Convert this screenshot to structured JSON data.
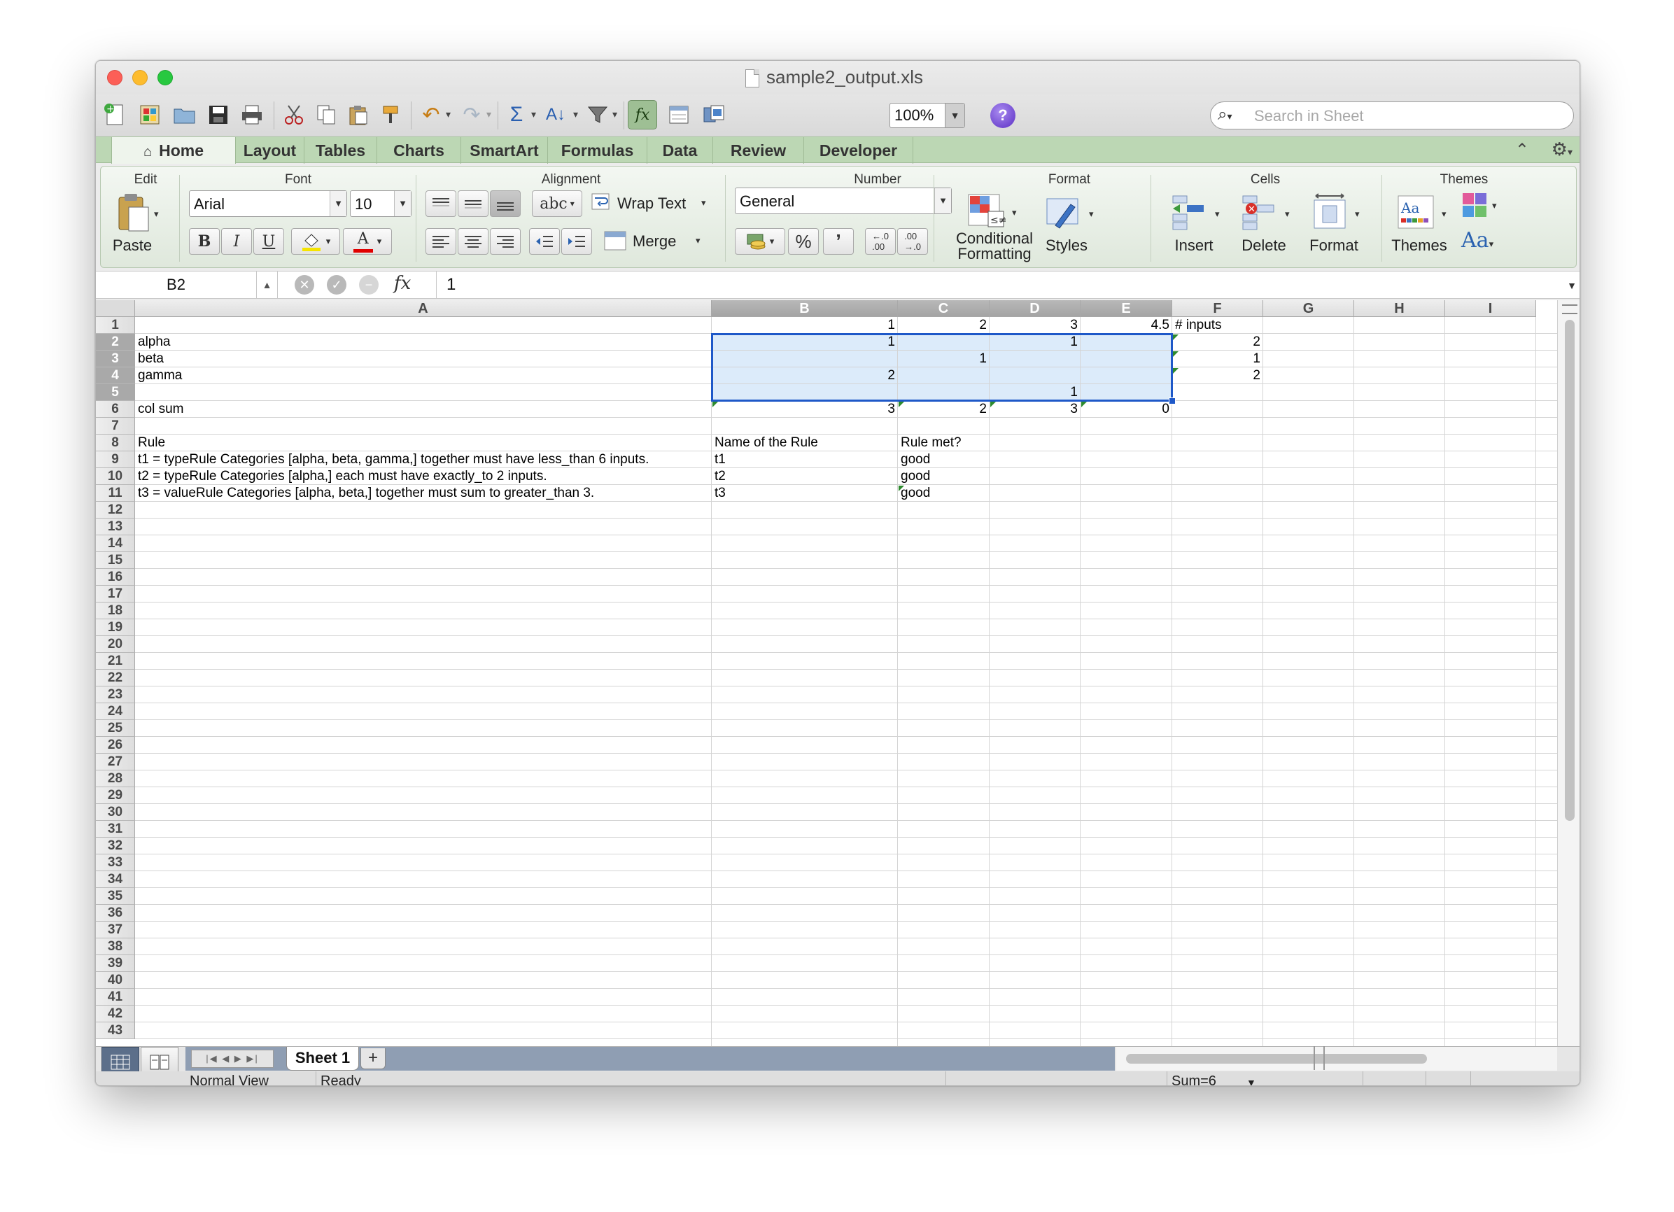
{
  "window": {
    "title": "sample2_output.xls"
  },
  "toolbar": {
    "zoom": "100%",
    "search_placeholder": "Search in Sheet",
    "help_label": "?"
  },
  "ribbon_tabs": [
    "Home",
    "Layout",
    "Tables",
    "Charts",
    "SmartArt",
    "Formulas",
    "Data",
    "Review",
    "Developer"
  ],
  "ribbon": {
    "groups": {
      "edit": "Edit",
      "font": "Font",
      "alignment": "Alignment",
      "number": "Number",
      "format": "Format",
      "cells": "Cells",
      "themes": "Themes"
    },
    "paste_label": "Paste",
    "font_name": "Arial",
    "font_size": "10",
    "bold": "B",
    "italic": "I",
    "underline": "U",
    "font_color_glyph": "A",
    "wrap_text_label": "Wrap Text",
    "merge_label": "Merge",
    "abc_label": "abc",
    "number_format": "General",
    "percent": "%",
    "comma": "’",
    "conditional_formatting_line1": "Conditional",
    "conditional_formatting_line2": "Formatting",
    "styles_label": "Styles",
    "insert_label": "Insert",
    "delete_label": "Delete",
    "format_label": "Format",
    "themes_label": "Themes",
    "aa_label": "Aa"
  },
  "formula_bar": {
    "name_box": "B2",
    "fx": "fx",
    "formula": "1"
  },
  "columns": [
    "A",
    "B",
    "C",
    "D",
    "E",
    "F",
    "G",
    "H",
    "I"
  ],
  "selected_columns": [
    "B",
    "C",
    "D",
    "E"
  ],
  "selected_rows": [
    2,
    3,
    4,
    5
  ],
  "row_count": 43,
  "cells": {
    "B1": "1",
    "C1": "2",
    "D1": "3",
    "E1": "4.5",
    "F1": "# inputs",
    "A2": "alpha",
    "B2": "1",
    "D2": "1",
    "F2": "2",
    "A3": "beta",
    "C3": "1",
    "F3": "1",
    "A4": "gamma",
    "B4": "2",
    "F4": "2",
    "D5": "1",
    "A6": "col sum",
    "B6": "3",
    "C6": "2",
    "D6": "3",
    "E6": "0",
    "A8": "Rule",
    "B8": "Name of the Rule",
    "C8": "Rule met?",
    "A9": "t1 = typeRule Categories [alpha, beta, gamma,] together must have less_than 6 inputs.",
    "B9": "t1",
    "C9": "good",
    "A10": "t2 = typeRule Categories [alpha,] each must have exactly_to 2 inputs.",
    "B10": "t2",
    "C10": "good",
    "A11": "t3 = valueRule Categories [alpha, beta,] together must sum to greater_than 3.",
    "B11": "t3",
    "C11": "good"
  },
  "sheet_tabs": [
    "Sheet 1"
  ],
  "add_sheet": "+",
  "status": {
    "view": "Normal View",
    "state": "Ready",
    "sum": "Sum=6"
  },
  "colors": {
    "accent_green": "#bcd7b4",
    "selection_border": "#1e58c8",
    "selection_fill": "#c0daf5",
    "comment_marker": "#2d8a2d"
  }
}
